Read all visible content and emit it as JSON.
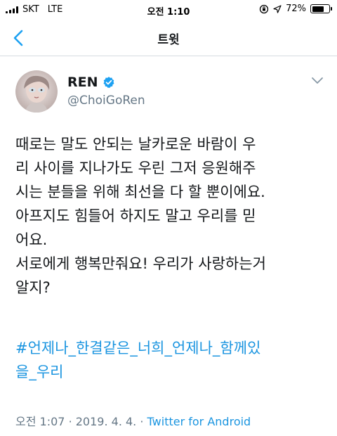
{
  "status_bar": {
    "carrier": "SKT",
    "network": "LTE",
    "time": "오전 1:10",
    "battery_percent_label": "72%",
    "battery_level": 0.72
  },
  "nav": {
    "title": "트윗",
    "back_icon": "chevron-left-icon"
  },
  "tweet": {
    "display_name": "REN",
    "verified": true,
    "handle": "@ChoiGoRen",
    "body_lines": [
      "때로는 말도 안되는 날카로운 바람이 우",
      "리 사이를 지나가도 우린 그저 응원해주",
      "시는 분들을 위해 최선을 다 할 뿐이에요.",
      "아프지도 힘들어 하지도 말고 우리를 믿",
      "어요.",
      "서로에게 행복만줘요! 우리가 사랑하는거",
      "알지?"
    ],
    "hashtag_lines": [
      "#언제나_한결같은_너희_언제나_함께있",
      "을_우리"
    ],
    "time": "오전 1:07",
    "date": "2019. 4. 4.",
    "separator": "·",
    "source": "Twitter for Android"
  },
  "colors": {
    "accent": "#1da1f2",
    "link": "#1b95e0",
    "secondary_text": "#657786",
    "primary_text": "#14171a"
  }
}
